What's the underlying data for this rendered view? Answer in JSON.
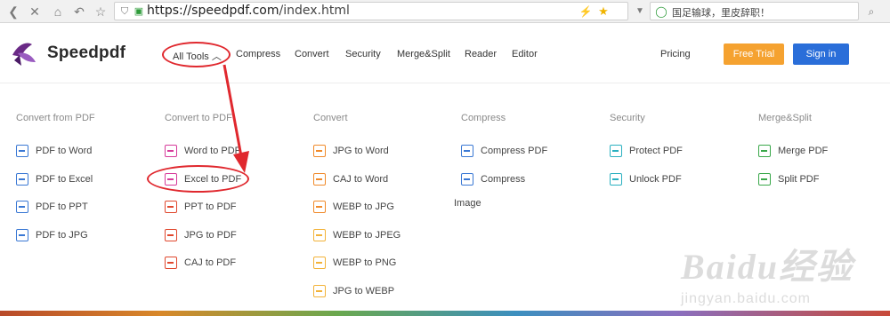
{
  "browser": {
    "url_host": "https://speedpdf.com",
    "url_path": "/index.html",
    "search_text": "国足输球，里皮辞职！"
  },
  "header": {
    "logo_text": "Speedpdf",
    "nav": [
      "All Tools",
      "Compress",
      "Convert",
      "Security",
      "Merge&Split",
      "Reader",
      "Editor"
    ],
    "pricing": "Pricing",
    "trial_button": "Free Trial",
    "signin_button": "Sign in",
    "colors": {
      "trial": "#f5a230",
      "signin": "#2a6ed9",
      "annotation": "#e0282e"
    }
  },
  "menu": {
    "columns": [
      {
        "title": "Convert from PDF",
        "items": [
          "PDF to Word",
          "PDF to Excel",
          "PDF to PPT",
          "PDF to JPG"
        ]
      },
      {
        "title": "Convert to PDF",
        "items": [
          "Word to PDF",
          "Excel to PDF",
          "PPT to PDF",
          "JPG to PDF",
          "CAJ to PDF"
        ]
      },
      {
        "title": "Convert",
        "items": [
          "JPG to Word",
          "CAJ to Word",
          "WEBP to JPG",
          "WEBP to JPEG",
          "WEBP to PNG",
          "JPG to WEBP"
        ]
      },
      {
        "title": "Compress",
        "items": [
          "Compress PDF",
          "Compress"
        ]
      },
      {
        "title": "Security",
        "items": [
          "Protect PDF",
          "Unlock PDF"
        ]
      },
      {
        "title": "Merge&Split",
        "items": [
          "Merge PDF",
          "Split PDF"
        ]
      }
    ],
    "stray_text": "Image"
  },
  "watermark": {
    "big": "Baidu经验",
    "small": "jingyan.baidu.com"
  }
}
